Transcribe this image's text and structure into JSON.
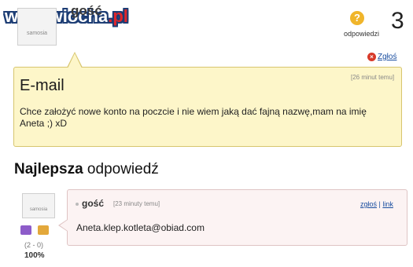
{
  "watermark": {
    "prefix": "www.wiocha",
    "suffix": ".pl"
  },
  "asker": {
    "avatar_text": "samosia",
    "name": "gość"
  },
  "question_stats": {
    "icon": "question-badge-icon",
    "count": "3",
    "label": "odpowiedzi"
  },
  "actions": {
    "report": "Zgłoś"
  },
  "question": {
    "time": "[26 minut temu]",
    "title": "E-mail",
    "body": "Chce założyć nowe konto na poczcie i nie wiem jaką dać fajną nazwę,mam na imię Aneta ;) xD"
  },
  "best_answer": {
    "heading_bold": "Najlepsza",
    "heading_rest": " odpowiedź",
    "avatar_text": "samosia",
    "author": "gość",
    "time": "[23 minuty temu]",
    "report_link": "zgłoś",
    "link_label": "link",
    "separator": "|",
    "body": "Aneta.klep.kotleta@obiad.com",
    "votes": "(2 - 0)",
    "percent": "100%"
  },
  "colors": {
    "question_bg": "#fdf6c9",
    "answer_bg": "#fcf3f3",
    "link": "#1a4ea0"
  }
}
